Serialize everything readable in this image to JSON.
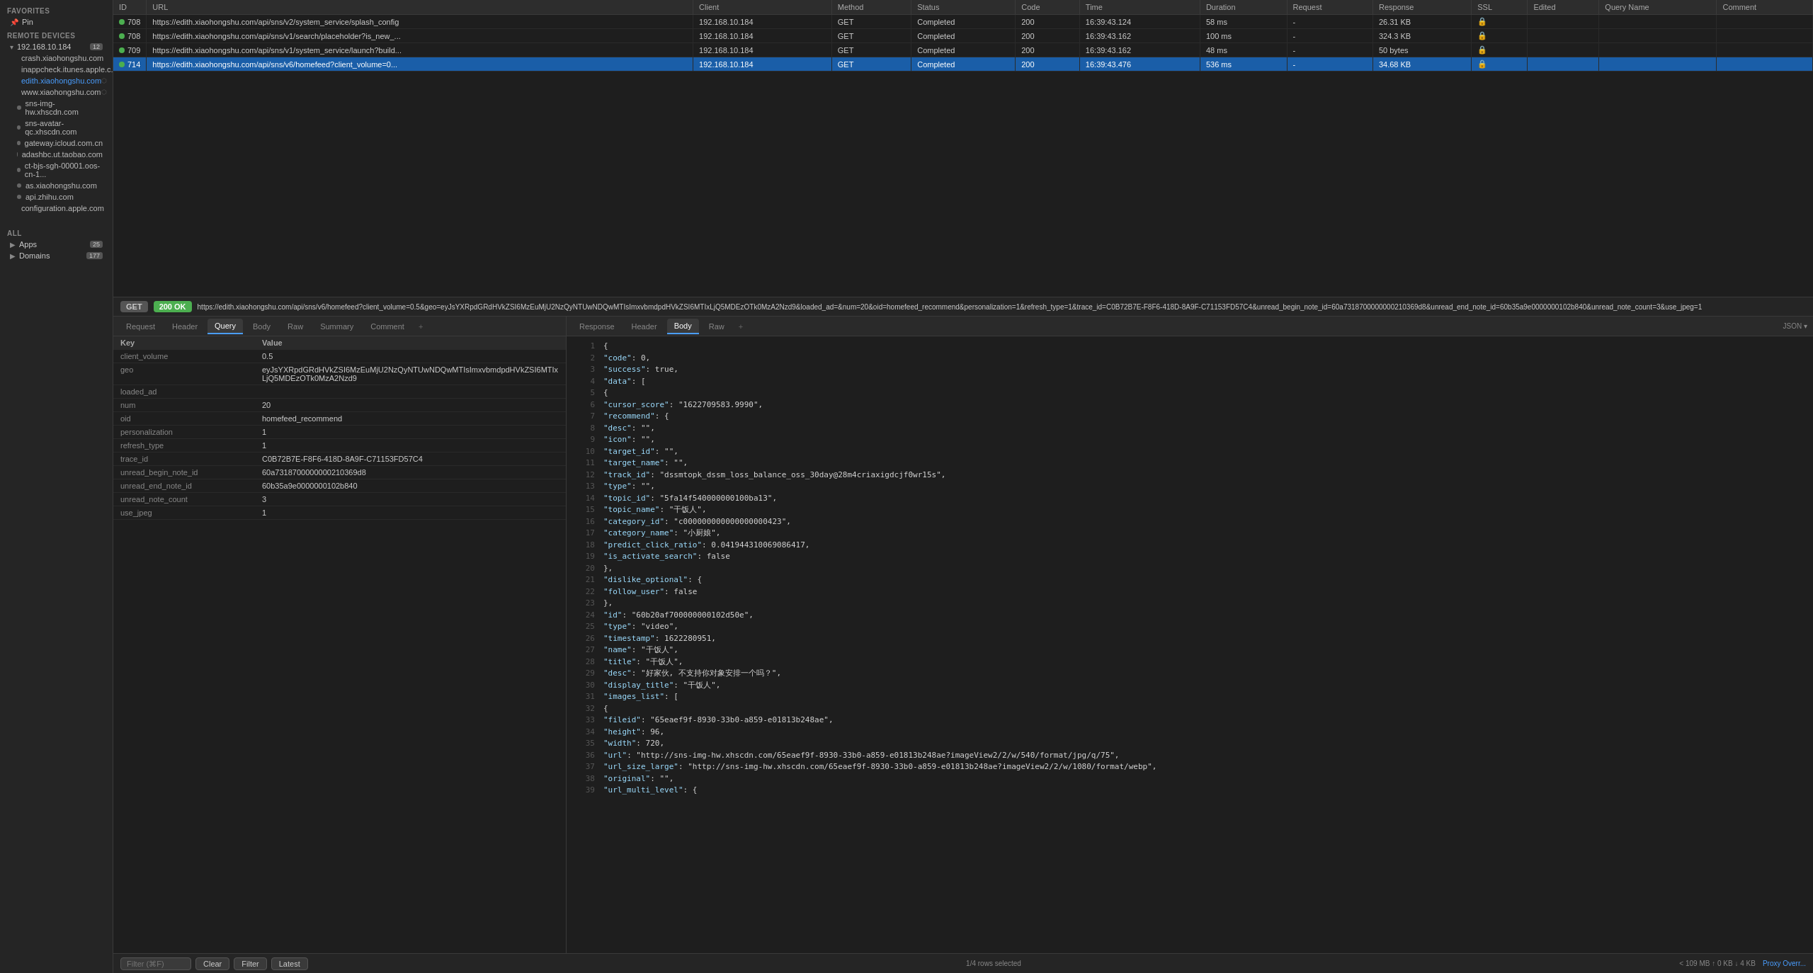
{
  "sidebar": {
    "favorites_label": "Favorites",
    "pin_label": "Pin",
    "remote_devices_label": "Remote devices",
    "devices": [
      {
        "name": "192.168.10.184",
        "badge": "12",
        "expanded": true
      },
      {
        "name": "crash.xiaohongshu.com",
        "dot": "gray"
      },
      {
        "name": "inappcheck.itunes.apple.c...",
        "dot": "gray"
      },
      {
        "name": "edith.xiaohongshu.com",
        "dot": "green",
        "active": true,
        "has_arrow": true
      },
      {
        "name": "www.xiaohongshu.com",
        "dot": "gray",
        "has_arrow": true
      },
      {
        "name": "sns-img-hw.xhscdn.com",
        "dot": "gray"
      },
      {
        "name": "sns-avatar-qc.xhscdn.com",
        "dot": "gray"
      },
      {
        "name": "gateway.icloud.com.cn",
        "dot": "gray"
      },
      {
        "name": "adashbc.ut.taobao.com",
        "dot": "gray"
      },
      {
        "name": "ct-bjs-sgh-00001.oos-cn-1...",
        "dot": "gray"
      },
      {
        "name": "as.xiaohongshu.com",
        "dot": "gray"
      },
      {
        "name": "api.zhihu.com",
        "dot": "gray"
      },
      {
        "name": "configuration.apple.com",
        "dot": "gray"
      }
    ],
    "all_label": "All",
    "apps_label": "Apps",
    "apps_count": "25",
    "domains_label": "Domains",
    "domains_count": "177"
  },
  "request_table": {
    "columns": [
      "ID",
      "URL",
      "Client",
      "Method",
      "Status",
      "Code",
      "Time",
      "Duration",
      "Request",
      "Response",
      "SSL",
      "Edited",
      "Query Name",
      "Comment"
    ],
    "rows": [
      {
        "id": "708",
        "url": "https://edith.xiaohongshu.com/api/sns/v2/system_service/splash_config",
        "client": "192.168.10.184",
        "method": "GET",
        "status": "Completed",
        "code": "200",
        "time": "16:39:43.124",
        "duration": "58 ms",
        "request": "-",
        "response": "26.31 KB",
        "ssl": true,
        "selected": false,
        "dot": "green"
      },
      {
        "id": "708",
        "url": "https://edith.xiaohongshu.com/api/sns/v1/search/placeholder?is_new_...",
        "client": "192.168.10.184",
        "method": "GET",
        "status": "Completed",
        "code": "200",
        "time": "16:39:43.162",
        "duration": "100 ms",
        "request": "-",
        "response": "324.3 KB",
        "ssl": true,
        "selected": false,
        "dot": "green"
      },
      {
        "id": "709",
        "url": "https://edith.xiaohongshu.com/api/sns/v1/system_service/launch?build...",
        "client": "192.168.10.184",
        "method": "GET",
        "status": "Completed",
        "code": "200",
        "time": "16:39:43.162",
        "duration": "48 ms",
        "request": "-",
        "response": "50 bytes",
        "ssl": true,
        "selected": false,
        "dot": "green"
      },
      {
        "id": "714",
        "url": "https://edith.xiaohongshu.com/api/sns/v6/homefeed?client_volume=0...",
        "client": "192.168.10.184",
        "method": "GET",
        "status": "Completed",
        "code": "200",
        "time": "16:39:43.476",
        "duration": "536 ms",
        "request": "-",
        "response": "34.68 KB",
        "ssl": true,
        "selected": true,
        "dot": "green"
      }
    ]
  },
  "url_bar": {
    "method": "GET",
    "status": "200 OK",
    "url": "https://edith.xiaohongshu.com/api/sns/v6/homefeed?client_volume=0.5&geo=eyJsYXRpdGRdHVkZSI6MzEuMjU2NzQyNTUwNDQwMTIsImxvbmdpdHVkZSI6MTIxLjQ5MDEzOTk0MzA2Nzd9&loaded_ad=&num=20&oid=homefeed_recommend&personalization=1&refresh_type=1&trace_id=C0B72B7E-F8F6-418D-8A9F-C71153FD57C4&unread_begin_note_id=60a7318700000000210369d8&unread_end_note_id=60b35a9e0000000102b840&unread_note_count=3&use_jpeg=1"
  },
  "request_panel": {
    "tabs": [
      "Request",
      "Header",
      "Query",
      "Body",
      "Raw",
      "Summary",
      "Comment"
    ],
    "active_tab": "Query",
    "plus_label": "+",
    "kv_header": {
      "key": "Key",
      "value": "Value"
    },
    "kv_rows": [
      {
        "key": "client_volume",
        "value": "0.5"
      },
      {
        "key": "geo",
        "value": "eyJsYXRpdGRdHVkZSI6MzEuMjU2NzQyNTUwNDQwMTIsImxvbmdpdHVkZSI6MTIxLjQ5MDEzOTk0MzA2Nzd9"
      },
      {
        "key": "loaded_ad",
        "value": ""
      },
      {
        "key": "num",
        "value": "20"
      },
      {
        "key": "oid",
        "value": "homefeed_recommend"
      },
      {
        "key": "personalization",
        "value": "1"
      },
      {
        "key": "refresh_type",
        "value": "1"
      },
      {
        "key": "trace_id",
        "value": "C0B72B7E-F8F6-418D-8A9F-C71153FD57C4"
      },
      {
        "key": "unread_begin_note_id",
        "value": "60a7318700000000210369d8"
      },
      {
        "key": "unread_end_note_id",
        "value": "60b35a9e0000000102b840"
      },
      {
        "key": "unread_note_count",
        "value": "3"
      },
      {
        "key": "use_jpeg",
        "value": "1"
      }
    ]
  },
  "response_panel": {
    "tabs": [
      "Response",
      "Header",
      "Body",
      "Raw"
    ],
    "active_tab": "Body",
    "plus_label": "+",
    "json_label": "JSON ▾",
    "json_lines": [
      {
        "lineno": "1",
        "content": "{"
      },
      {
        "lineno": "2",
        "content": "  \"code\": 0,"
      },
      {
        "lineno": "3",
        "content": "  \"success\": true,"
      },
      {
        "lineno": "4",
        "content": "  \"data\": ["
      },
      {
        "lineno": "5",
        "content": "    {"
      },
      {
        "lineno": "6",
        "content": "      \"cursor_score\": \"1622709583.9990\","
      },
      {
        "lineno": "7",
        "content": "      \"recommend\": {"
      },
      {
        "lineno": "8",
        "content": "        \"desc\": \"\","
      },
      {
        "lineno": "9",
        "content": "        \"icon\": \"\","
      },
      {
        "lineno": "10",
        "content": "        \"target_id\": \"\","
      },
      {
        "lineno": "11",
        "content": "        \"target_name\": \"\","
      },
      {
        "lineno": "12",
        "content": "        \"track_id\": \"dssmtopk_dssm_loss_balance_oss_30day@28m4criaxigdcjf0wr15s\","
      },
      {
        "lineno": "13",
        "content": "        \"type\": \"\","
      },
      {
        "lineno": "14",
        "content": "        \"topic_id\": \"5fa14f540000000100ba13\","
      },
      {
        "lineno": "15",
        "content": "        \"topic_name\": \"干饭人\","
      },
      {
        "lineno": "16",
        "content": "        \"category_id\": \"c000000000000000000423\","
      },
      {
        "lineno": "17",
        "content": "        \"category_name\": \"小厨娘\","
      },
      {
        "lineno": "18",
        "content": "        \"predict_click_ratio\": 0.041944310069086417,"
      },
      {
        "lineno": "19",
        "content": "        \"is_activate_search\": false"
      },
      {
        "lineno": "20",
        "content": "      },"
      },
      {
        "lineno": "21",
        "content": "      \"dislike_optional\": {"
      },
      {
        "lineno": "22",
        "content": "        \"follow_user\": false"
      },
      {
        "lineno": "23",
        "content": "      },"
      },
      {
        "lineno": "24",
        "content": "      \"id\": \"60b20af700000000102d50e\","
      },
      {
        "lineno": "25",
        "content": "      \"type\": \"video\","
      },
      {
        "lineno": "26",
        "content": "      \"timestamp\": 1622280951,"
      },
      {
        "lineno": "27",
        "content": "      \"name\": \"干饭人\","
      },
      {
        "lineno": "28",
        "content": "      \"title\": \"干饭人\","
      },
      {
        "lineno": "29",
        "content": "      \"desc\": \"好家伙, 不支持你对象安排一个吗？\","
      },
      {
        "lineno": "30",
        "content": "      \"display_title\": \"干饭人\","
      },
      {
        "lineno": "31",
        "content": "      \"images_list\": ["
      },
      {
        "lineno": "32",
        "content": "        {"
      },
      {
        "lineno": "33",
        "content": "          \"fileid\": \"65eaef9f-8930-33b0-a859-e01813b248ae\","
      },
      {
        "lineno": "34",
        "content": "          \"height\": 96,"
      },
      {
        "lineno": "35",
        "content": "          \"width\": 720,"
      },
      {
        "lineno": "36",
        "content": "          \"url\": \"http://sns-img-hw.xhscdn.com/65eaef9f-8930-33b0-a859-e01813b248ae?imageView2/2/w/540/format/jpg/q/75\","
      },
      {
        "lineno": "37",
        "content": "          \"url_size_large\": \"http://sns-img-hw.xhscdn.com/65eaef9f-8930-33b0-a859-e01813b248ae?imageView2/2/w/1080/format/webp\","
      },
      {
        "lineno": "38",
        "content": "          \"original\": \"\","
      },
      {
        "lineno": "39",
        "content": "          \"url_multi_level\": {"
      }
    ]
  },
  "bottom_bar": {
    "filter_placeholder": "Filter (⌘F)",
    "clear_label": "Clear",
    "filter_label": "Filter",
    "latest_label": "Latest",
    "rows_selected": "1/4 rows selected",
    "stats": "< 109 MB ↑ 0 KB ↓ 4 KB",
    "proxy_override": "Proxy Overr..."
  }
}
